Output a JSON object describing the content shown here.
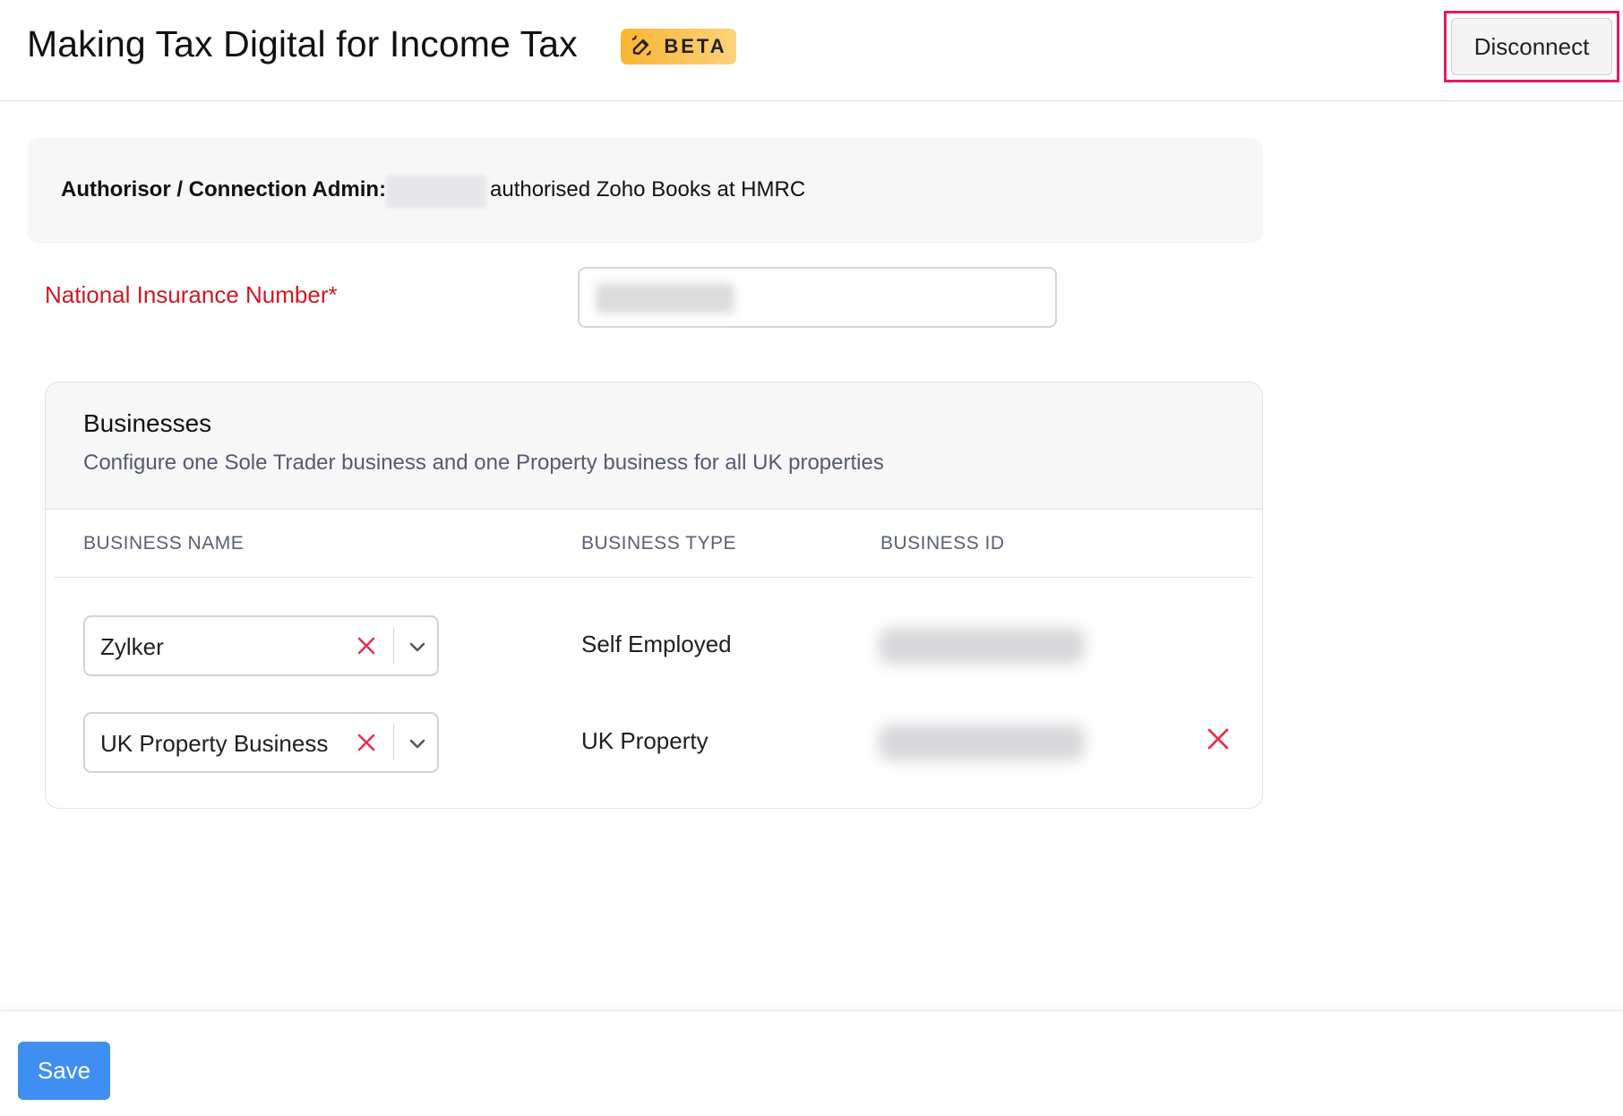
{
  "header": {
    "title": "Making Tax Digital for Income Tax",
    "badge": "BETA",
    "disconnect_label": "Disconnect"
  },
  "auth": {
    "label": "Authorisor / Connection Admin:",
    "text": "authorised Zoho Books at HMRC"
  },
  "ni": {
    "label": "National Insurance Number*"
  },
  "businesses": {
    "title": "Businesses",
    "subtitle": "Configure one Sole Trader business and one Property business for all UK properties",
    "columns": [
      "BUSINESS NAME",
      "BUSINESS TYPE",
      "BUSINESS ID"
    ],
    "rows": [
      {
        "name": "Zylker",
        "type": "Self Employed"
      },
      {
        "name": "UK Property Business",
        "type": "UK Property"
      }
    ]
  },
  "footer": {
    "save_label": "Save"
  },
  "colors": {
    "accent": "#3f8ff2",
    "required_label": "#d0191f",
    "clear_icon": "#e8304d",
    "highlight_outline": "#e01e5a"
  }
}
